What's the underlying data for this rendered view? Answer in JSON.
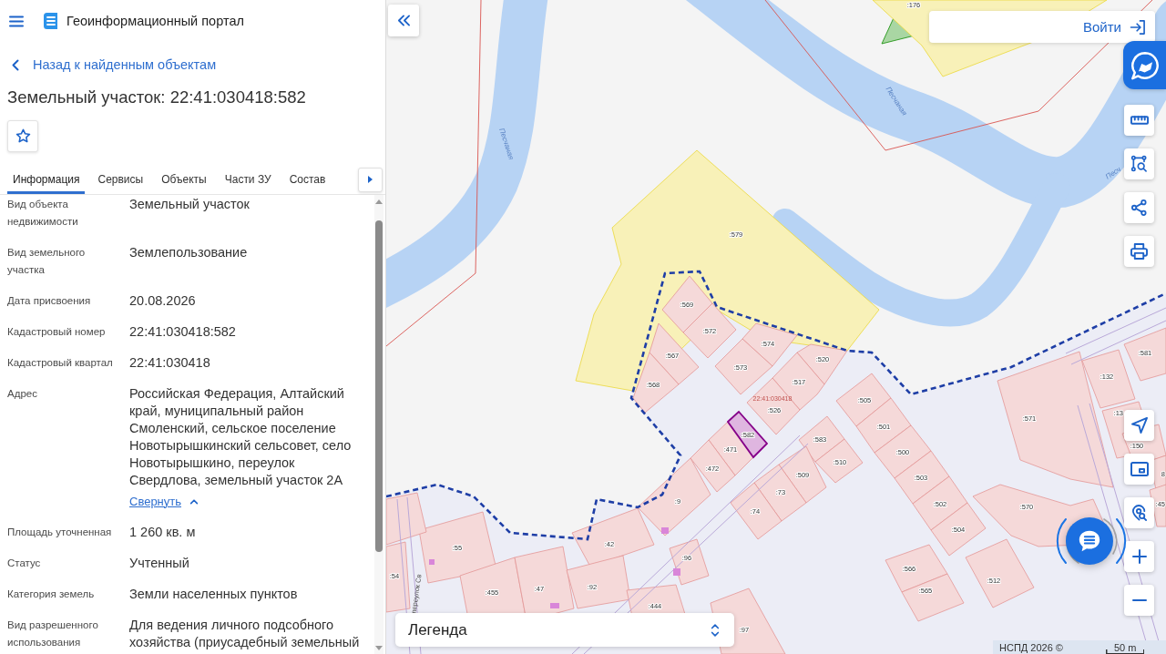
{
  "header": {
    "title": "Геоинформационный портал"
  },
  "back_link": {
    "label": "Назад к найденным объектам"
  },
  "object_title": "Земельный участок: 22:41:030418:582",
  "tabs": [
    {
      "label": "Информация",
      "selected": true
    },
    {
      "label": "Сервисы",
      "selected": false
    },
    {
      "label": "Объекты",
      "selected": false
    },
    {
      "label": "Части ЗУ",
      "selected": false
    },
    {
      "label": "Состав",
      "selected": false
    }
  ],
  "properties": [
    {
      "label": "Вид объекта недвижимости",
      "value": "Земельный участок"
    },
    {
      "label": "Вид земельного участка",
      "value": "Землепользование"
    },
    {
      "label": "Дата присвоения",
      "value": "20.08.2026"
    },
    {
      "label": "Кадастровый номер",
      "value": "22:41:030418:582"
    },
    {
      "label": "Кадастровый квартал",
      "value": "22:41:030418"
    },
    {
      "label": "Адрес",
      "value": "Российская Федерация, Алтайский край, муниципальный район Смоленский, сельское поселение Новотырышкинский сельсовет, село Новотырышкино, переулок Свердлова, земельный участок 2А",
      "toggle": "Свернуть"
    },
    {
      "label": "Площадь уточненная",
      "value": "1 260 кв. м"
    },
    {
      "label": "Статус",
      "value": "Учтенный"
    },
    {
      "label": "Категория земель",
      "value": "Земли населенных пунктов"
    },
    {
      "label": "Вид разрешенного использования",
      "value": "Для ведения личного подсобного хозяйства (приусадебный земельный"
    }
  ],
  "map": {
    "login": {
      "label": "Войти"
    },
    "parcels": [
      {
        "label": ":176",
        "color": "#a9d6a3",
        "selected": false
      },
      {
        "color": "#f8f1b8",
        "selected": false
      },
      {
        "label": ":579",
        "color": "#f8f1b8",
        "selected": false
      },
      {
        "label": ":569",
        "color": "#f5d9d9",
        "selected": false
      },
      {
        "label": ":572",
        "color": "#f5d9d9",
        "selected": false
      },
      {
        "label": ":567",
        "color": "#f5d9d9",
        "selected": false
      },
      {
        "label": ":568",
        "color": "#f5d9d9",
        "selected": false
      },
      {
        "label": ":574",
        "color": "#f5d9d9",
        "selected": false
      },
      {
        "label": ":573",
        "color": "#f5d9d9",
        "selected": false
      },
      {
        "label": ":520",
        "color": "#f5d9d9",
        "selected": false
      },
      {
        "label": ":517",
        "color": "#f5d9d9",
        "selected": false
      },
      {
        "label": ":526",
        "color": "#f5d9d9",
        "selected": false
      },
      {
        "label": ":582",
        "color": "#dfb6e0",
        "selected": true
      },
      {
        "label": ":471",
        "color": "#f5d9d9",
        "selected": false
      },
      {
        "label": ":472",
        "color": "#f5d9d9",
        "selected": false
      },
      {
        "label": ":9",
        "color": "#f5d9d9",
        "selected": false
      },
      {
        "label": ":583",
        "color": "#f5d9d9",
        "selected": false
      },
      {
        "label": ":510",
        "color": "#f5d9d9",
        "selected": false
      },
      {
        "label": ":509",
        "color": "#f5d9d9",
        "selected": false
      },
      {
        "label": ":73",
        "color": "#f5d9d9",
        "selected": false
      },
      {
        "label": ":74",
        "color": "#f5d9d9",
        "selected": false
      },
      {
        "label": ":505",
        "color": "#f5d9d9",
        "selected": false
      },
      {
        "label": ":501",
        "color": "#f5d9d9",
        "selected": false
      },
      {
        "label": ":500",
        "color": "#f5d9d9",
        "selected": false
      },
      {
        "label": ":503",
        "color": "#f5d9d9",
        "selected": false
      },
      {
        "label": ":502",
        "color": "#f5d9d9",
        "selected": false
      },
      {
        "label": ":504",
        "color": "#f5d9d9",
        "selected": false
      },
      {
        "label": ":571",
        "color": "#f5d9d9",
        "selected": false
      },
      {
        "label": ":132",
        "color": "#f5d9d9",
        "selected": false
      },
      {
        "label": ":581",
        "color": "#f5d9d9",
        "selected": false
      },
      {
        "label": ":13",
        "color": "#f5d9d9",
        "selected": false
      },
      {
        "label": ":150",
        "color": "#f5d9d9",
        "selected": false
      },
      {
        "label": "8",
        "color": "#f5d9d9",
        "selected": false
      },
      {
        "label": ":45",
        "color": "#f5d9d9",
        "selected": false
      },
      {
        "label": ":570",
        "color": "#f5d9d9",
        "selected": false
      },
      {
        "label": ":512",
        "color": "#f5d9d9",
        "selected": false
      },
      {
        "label": ":566",
        "color": "#f5d9d9",
        "selected": false
      },
      {
        "label": ":565",
        "color": "#f5d9d9",
        "selected": false
      },
      {
        "label": ":55",
        "color": "#f5d9d9",
        "selected": false
      },
      {
        "label": ":54",
        "color": "#f5d9d9",
        "selected": false
      },
      {
        "label": ":42",
        "color": "#f5d9d9",
        "selected": false
      },
      {
        "label": ":455",
        "color": "#f5d9d9",
        "selected": false
      },
      {
        "label": ":47",
        "color": "#f5d9d9",
        "selected": false
      },
      {
        "label": ":92",
        "color": "#f5d9d9",
        "selected": false
      },
      {
        "label": ":96",
        "color": "#f5d9d9",
        "selected": false
      },
      {
        "label": ":444",
        "color": "#f5d9d9",
        "selected": false
      },
      {
        "label": ":97",
        "color": "#f5d9d9",
        "selected": false
      },
      {
        "color": "#f5d9d9",
        "selected": false
      }
    ],
    "quarter_label": "22:41:030418",
    "river_labels": [
      "Песчаная",
      "Песчаная",
      "Песч"
    ],
    "street_label": "переулок Св",
    "legend": {
      "label": "Легенда"
    },
    "attribution": "НСПД 2026 ©",
    "scale": "50 m"
  }
}
